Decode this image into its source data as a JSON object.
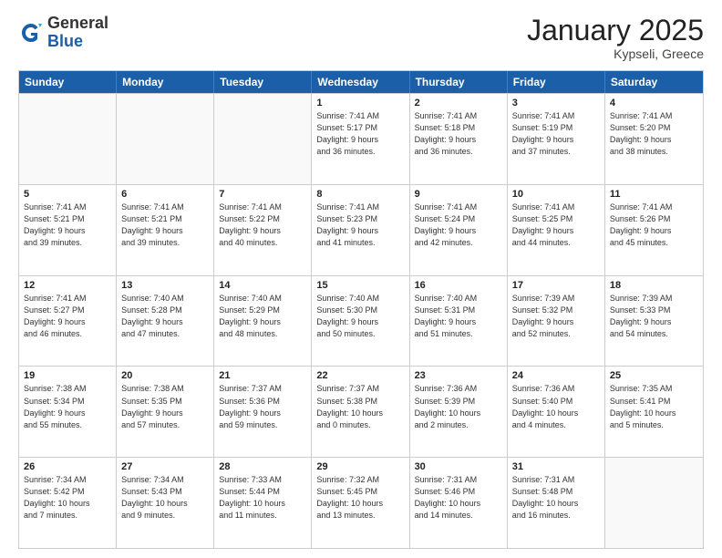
{
  "logo": {
    "general": "General",
    "blue": "Blue"
  },
  "header": {
    "title": "January 2025",
    "subtitle": "Kypseli, Greece"
  },
  "weekdays": [
    "Sunday",
    "Monday",
    "Tuesday",
    "Wednesday",
    "Thursday",
    "Friday",
    "Saturday"
  ],
  "weeks": [
    [
      {
        "day": "",
        "info": "",
        "empty": true
      },
      {
        "day": "",
        "info": "",
        "empty": true
      },
      {
        "day": "",
        "info": "",
        "empty": true
      },
      {
        "day": "1",
        "info": "Sunrise: 7:41 AM\nSunset: 5:17 PM\nDaylight: 9 hours\nand 36 minutes."
      },
      {
        "day": "2",
        "info": "Sunrise: 7:41 AM\nSunset: 5:18 PM\nDaylight: 9 hours\nand 36 minutes."
      },
      {
        "day": "3",
        "info": "Sunrise: 7:41 AM\nSunset: 5:19 PM\nDaylight: 9 hours\nand 37 minutes."
      },
      {
        "day": "4",
        "info": "Sunrise: 7:41 AM\nSunset: 5:20 PM\nDaylight: 9 hours\nand 38 minutes."
      }
    ],
    [
      {
        "day": "5",
        "info": "Sunrise: 7:41 AM\nSunset: 5:21 PM\nDaylight: 9 hours\nand 39 minutes."
      },
      {
        "day": "6",
        "info": "Sunrise: 7:41 AM\nSunset: 5:21 PM\nDaylight: 9 hours\nand 39 minutes."
      },
      {
        "day": "7",
        "info": "Sunrise: 7:41 AM\nSunset: 5:22 PM\nDaylight: 9 hours\nand 40 minutes."
      },
      {
        "day": "8",
        "info": "Sunrise: 7:41 AM\nSunset: 5:23 PM\nDaylight: 9 hours\nand 41 minutes."
      },
      {
        "day": "9",
        "info": "Sunrise: 7:41 AM\nSunset: 5:24 PM\nDaylight: 9 hours\nand 42 minutes."
      },
      {
        "day": "10",
        "info": "Sunrise: 7:41 AM\nSunset: 5:25 PM\nDaylight: 9 hours\nand 44 minutes."
      },
      {
        "day": "11",
        "info": "Sunrise: 7:41 AM\nSunset: 5:26 PM\nDaylight: 9 hours\nand 45 minutes."
      }
    ],
    [
      {
        "day": "12",
        "info": "Sunrise: 7:41 AM\nSunset: 5:27 PM\nDaylight: 9 hours\nand 46 minutes."
      },
      {
        "day": "13",
        "info": "Sunrise: 7:40 AM\nSunset: 5:28 PM\nDaylight: 9 hours\nand 47 minutes."
      },
      {
        "day": "14",
        "info": "Sunrise: 7:40 AM\nSunset: 5:29 PM\nDaylight: 9 hours\nand 48 minutes."
      },
      {
        "day": "15",
        "info": "Sunrise: 7:40 AM\nSunset: 5:30 PM\nDaylight: 9 hours\nand 50 minutes."
      },
      {
        "day": "16",
        "info": "Sunrise: 7:40 AM\nSunset: 5:31 PM\nDaylight: 9 hours\nand 51 minutes."
      },
      {
        "day": "17",
        "info": "Sunrise: 7:39 AM\nSunset: 5:32 PM\nDaylight: 9 hours\nand 52 minutes."
      },
      {
        "day": "18",
        "info": "Sunrise: 7:39 AM\nSunset: 5:33 PM\nDaylight: 9 hours\nand 54 minutes."
      }
    ],
    [
      {
        "day": "19",
        "info": "Sunrise: 7:38 AM\nSunset: 5:34 PM\nDaylight: 9 hours\nand 55 minutes."
      },
      {
        "day": "20",
        "info": "Sunrise: 7:38 AM\nSunset: 5:35 PM\nDaylight: 9 hours\nand 57 minutes."
      },
      {
        "day": "21",
        "info": "Sunrise: 7:37 AM\nSunset: 5:36 PM\nDaylight: 9 hours\nand 59 minutes."
      },
      {
        "day": "22",
        "info": "Sunrise: 7:37 AM\nSunset: 5:38 PM\nDaylight: 10 hours\nand 0 minutes."
      },
      {
        "day": "23",
        "info": "Sunrise: 7:36 AM\nSunset: 5:39 PM\nDaylight: 10 hours\nand 2 minutes."
      },
      {
        "day": "24",
        "info": "Sunrise: 7:36 AM\nSunset: 5:40 PM\nDaylight: 10 hours\nand 4 minutes."
      },
      {
        "day": "25",
        "info": "Sunrise: 7:35 AM\nSunset: 5:41 PM\nDaylight: 10 hours\nand 5 minutes."
      }
    ],
    [
      {
        "day": "26",
        "info": "Sunrise: 7:34 AM\nSunset: 5:42 PM\nDaylight: 10 hours\nand 7 minutes."
      },
      {
        "day": "27",
        "info": "Sunrise: 7:34 AM\nSunset: 5:43 PM\nDaylight: 10 hours\nand 9 minutes."
      },
      {
        "day": "28",
        "info": "Sunrise: 7:33 AM\nSunset: 5:44 PM\nDaylight: 10 hours\nand 11 minutes."
      },
      {
        "day": "29",
        "info": "Sunrise: 7:32 AM\nSunset: 5:45 PM\nDaylight: 10 hours\nand 13 minutes."
      },
      {
        "day": "30",
        "info": "Sunrise: 7:31 AM\nSunset: 5:46 PM\nDaylight: 10 hours\nand 14 minutes."
      },
      {
        "day": "31",
        "info": "Sunrise: 7:31 AM\nSunset: 5:48 PM\nDaylight: 10 hours\nand 16 minutes."
      },
      {
        "day": "",
        "info": "",
        "empty": true
      }
    ]
  ]
}
